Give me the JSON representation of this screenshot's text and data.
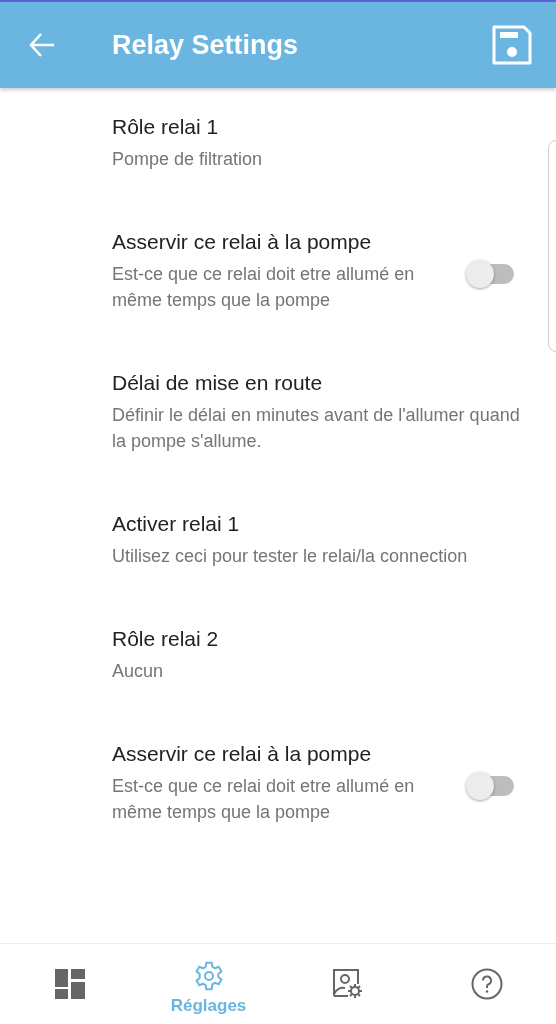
{
  "app_bar": {
    "title": "Relay Settings"
  },
  "settings": [
    {
      "kind": "text",
      "title": "Rôle relai 1",
      "subtitle": "Pompe de filtration"
    },
    {
      "kind": "toggle",
      "title": "Asservir ce relai à la pompe",
      "subtitle": "Est-ce que ce relai doit etre allumé en même temps que la pompe",
      "on": false
    },
    {
      "kind": "text",
      "title": "Délai de mise en route",
      "subtitle": "Définir le délai en minutes avant de l'allumer quand la pompe s'allume."
    },
    {
      "kind": "text",
      "title": "Activer relai 1",
      "subtitle": "Utilisez ceci pour tester le relai/la connection"
    },
    {
      "kind": "text",
      "title": "Rôle relai 2",
      "subtitle": "Aucun"
    },
    {
      "kind": "toggle",
      "title": "Asservir ce relai à la pompe",
      "subtitle": "Est-ce que ce relai doit etre allumé en même temps que la pompe",
      "on": false
    }
  ],
  "bottom_nav": [
    {
      "kind": "dashboard",
      "selected": false
    },
    {
      "kind": "settings",
      "label": "Réglages",
      "selected": true
    },
    {
      "kind": "profile-settings",
      "selected": false
    },
    {
      "kind": "help",
      "selected": false
    }
  ]
}
